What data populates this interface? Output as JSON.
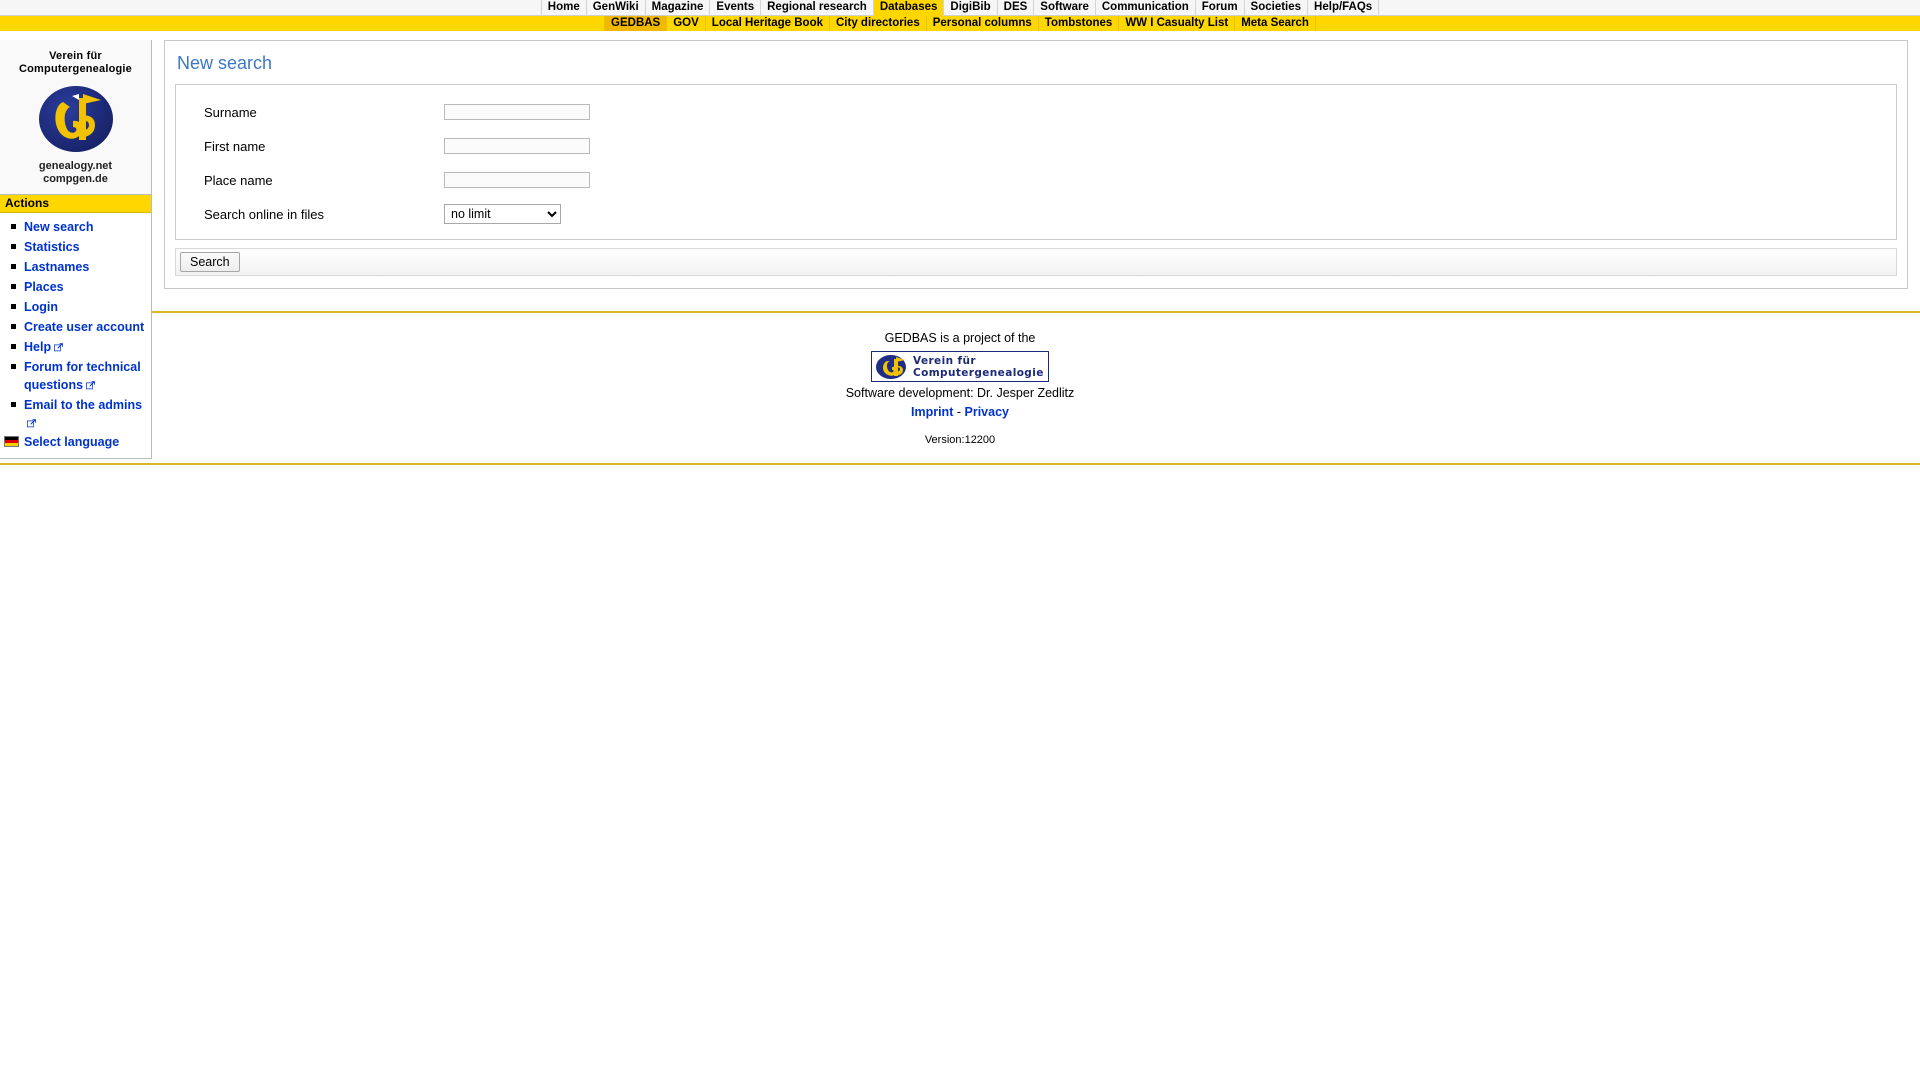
{
  "topnav": {
    "items": [
      {
        "label": "Home",
        "active": false
      },
      {
        "label": "GenWiki",
        "active": false
      },
      {
        "label": "Magazine",
        "active": false
      },
      {
        "label": "Events",
        "active": false
      },
      {
        "label": "Regional research",
        "active": false
      },
      {
        "label": "Databases",
        "active": true
      },
      {
        "label": "DigiBib",
        "active": false
      },
      {
        "label": "DES",
        "active": false
      },
      {
        "label": "Software",
        "active": false
      },
      {
        "label": "Communication",
        "active": false
      },
      {
        "label": "Forum",
        "active": false
      },
      {
        "label": "Societies",
        "active": false
      },
      {
        "label": "Help/FAQs",
        "active": false
      }
    ]
  },
  "subnav": {
    "items": [
      {
        "label": "GEDBAS",
        "active": true
      },
      {
        "label": "GOV",
        "active": false
      },
      {
        "label": "Local Heritage Book",
        "active": false
      },
      {
        "label": "City directories",
        "active": false
      },
      {
        "label": "Personal columns",
        "active": false
      },
      {
        "label": "Tombstones",
        "active": false
      },
      {
        "label": "WW I Casualty List",
        "active": false
      },
      {
        "label": "Meta Search",
        "active": false
      }
    ]
  },
  "sidebar": {
    "logo": {
      "title_line1": "Verein für",
      "title_line2": "Computergenealogie",
      "sub_line1": "genealogy.net",
      "sub_line2": "compgen.de"
    },
    "actions_header": "Actions",
    "items": [
      {
        "label": "New search",
        "external": false,
        "icon": "bullet"
      },
      {
        "label": "Statistics",
        "external": false,
        "icon": "bullet"
      },
      {
        "label": "Lastnames",
        "external": false,
        "icon": "bullet"
      },
      {
        "label": "Places",
        "external": false,
        "icon": "bullet"
      },
      {
        "label": "Login",
        "external": false,
        "icon": "bullet"
      },
      {
        "label": "Create user account",
        "external": false,
        "icon": "bullet"
      },
      {
        "label": "Help",
        "external": true,
        "icon": "bullet"
      },
      {
        "label": "Forum for technical questions",
        "external": true,
        "icon": "bullet"
      },
      {
        "label": "Email to the admins",
        "external": true,
        "icon": "bullet"
      },
      {
        "label": "Select language",
        "external": false,
        "icon": "german-flag"
      }
    ]
  },
  "main": {
    "title": "New search",
    "fields": [
      {
        "label": "Surname",
        "value": "",
        "placeholder": "",
        "type": "text"
      },
      {
        "label": "First name",
        "value": "",
        "placeholder": "",
        "type": "text"
      },
      {
        "label": "Place name",
        "value": "",
        "placeholder": "",
        "type": "text"
      }
    ],
    "select_field": {
      "label": "Search online in files",
      "selected": "no limit",
      "options": [
        "no limit"
      ]
    },
    "submit_label": "Search"
  },
  "footer": {
    "project_line": "GEDBAS is a project of the",
    "banner_line1": "Verein für",
    "banner_line2": "Computergenealogie",
    "developer_line": "Software development: Dr. Jesper Zedlitz",
    "imprint_label": "Imprint",
    "separator": "-",
    "privacy_label": "Privacy",
    "version": "Version:12200"
  },
  "colors": {
    "accent_yellow": "#ffd700",
    "active_subnav": "#f0b800",
    "link_blue": "#0033cc",
    "title_blue": "#3b78c3",
    "rule_gold": "#d8b828"
  }
}
